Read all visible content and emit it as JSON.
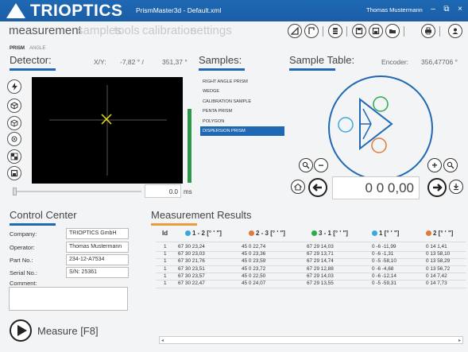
{
  "titlebar": {
    "logo_text": "TRIOPTICS",
    "app_title": "PrismMaster3d - Default.xml",
    "user": "Thomas Mustermann",
    "minimize": "–",
    "maximize": "⧉",
    "close": "×"
  },
  "menu": {
    "items": [
      "measurement",
      "samples",
      "tools",
      "calibration",
      "settings"
    ],
    "active": "measurement"
  },
  "toolbar_icons": [
    "prism-angle-icon",
    "flag-icon",
    "database-icon",
    "save-icon",
    "save-as-icon",
    "folder-icon",
    "print-icon",
    "user-icon"
  ],
  "subtabs": {
    "prism": "PRISM",
    "angle": "ANGLE"
  },
  "detector": {
    "title": "Detector:",
    "xy_label": "X/Y:",
    "x_value": "-7,82 ° /",
    "y_value": "351,37 °",
    "exposure_value": "0.0",
    "exposure_unit": "ms",
    "slider_fraction": 0.0,
    "intensity_fraction": 0.7
  },
  "samples": {
    "title": "Samples:",
    "items": [
      "RIGHT ANGLE PRISM",
      "WEDGE",
      "CALIBRATION SAMPLE",
      "PENTA PRISM",
      "POLYGON",
      "DISPERSION PRISM"
    ],
    "selected": "DISPERSION PRISM"
  },
  "sample_table": {
    "title": "Sample Table:",
    "encoder_label": "Encoder:",
    "encoder_value": "356,47706 °",
    "angle_value": "0 0 0,00"
  },
  "control_center": {
    "title": "Control Center",
    "fields": [
      {
        "label": "Company:",
        "value": "TRIOPTICS GmbH"
      },
      {
        "label": "Operator:",
        "value": "Thomas Mustermann"
      },
      {
        "label": "Part No.:",
        "value": "234-12-A7534"
      },
      {
        "label": "Serial No.:",
        "value": "S/N: 25361"
      }
    ],
    "comment_label": "Comment:",
    "comment_value": "",
    "measure_label": "Measure [F8]"
  },
  "results": {
    "title": "Measurement Results",
    "columns": [
      {
        "label": "Id",
        "dot": ""
      },
      {
        "label": "1 - 2  [° ' \"]",
        "dot": "#3ba7e0"
      },
      {
        "label": "2 - 3  [° ' \"]",
        "dot": "#e07a3a"
      },
      {
        "label": "3 - 1  [° ' \"]",
        "dot": "#2faa4a"
      },
      {
        "label": "1  [° ' \"]",
        "dot": "#3ba7e0"
      },
      {
        "label": "2  [° ' \"]",
        "dot": "#e07a3a"
      }
    ],
    "rows": [
      [
        "1",
        "67 30 23,24",
        "45 0 22,74",
        "67 29 14,03",
        "0 -6 -11,99",
        "0 14 1,41"
      ],
      [
        "1",
        "67 30 23,03",
        "45 0 23,36",
        "67 29 13,71",
        "0 -6 -1,31",
        "0 13 58,10"
      ],
      [
        "1",
        "67 30 21,76",
        "45 0 23,59",
        "67 29 14,74",
        "0 -5 -58,10",
        "0 13 58,29"
      ],
      [
        "1",
        "67 30 23,51",
        "45 0 23,72",
        "67 29 12,88",
        "0 -6 -4,68",
        "0 13 56,72"
      ],
      [
        "1",
        "67 30 23,57",
        "45 0 22,50",
        "67 29 14,03",
        "0 -6 -12,14",
        "0 14 7,42"
      ],
      [
        "1",
        "67 30 22,47",
        "45 0 24,07",
        "67 29 13,55",
        "0 -5 -59,31",
        "0 14 7,73"
      ]
    ]
  },
  "colors": {
    "accent": "#1f68b3",
    "orange": "#f09a3e",
    "green": "#2a9a4a",
    "blue_light": "#3ba7e0",
    "crosshair": "#e8e020"
  }
}
